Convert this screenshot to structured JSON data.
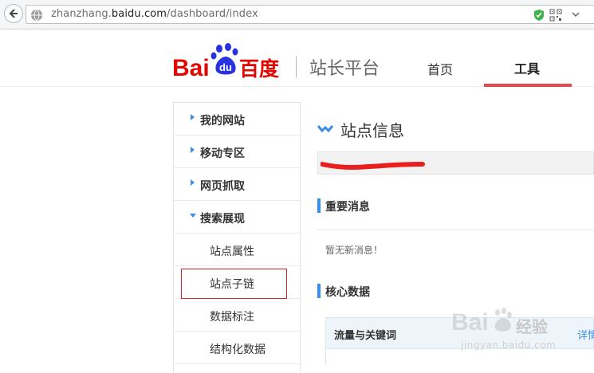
{
  "browser": {
    "url_prefix": "zhanzhang.",
    "url_domain": "baidu.com",
    "url_path": "/dashboard/index"
  },
  "header": {
    "logo_text_bai": "Bai",
    "logo_text_du": "du",
    "logo_text_cn": "百度",
    "platform": "站长平台",
    "nav": [
      {
        "label": "首页"
      },
      {
        "label": "工具"
      }
    ],
    "accent_color": "#e8484d"
  },
  "sidebar": {
    "items": [
      {
        "label": "我的网站"
      },
      {
        "label": "移动专区"
      },
      {
        "label": "网页抓取"
      },
      {
        "label": "搜索展现"
      }
    ],
    "subitems": [
      {
        "label": "站点属性"
      },
      {
        "label": "站点子链"
      },
      {
        "label": "数据标注"
      },
      {
        "label": "结构化数据"
      }
    ]
  },
  "main": {
    "title": "站点信息",
    "sections": [
      {
        "title": "重要消息"
      },
      {
        "title": "核心数据"
      }
    ],
    "no_message": "暂无新消息！",
    "table_header": "流量与关键词",
    "table_link": "详情",
    "link_color": "#3a8ee6"
  },
  "watermark": {
    "logo_text": "Bai",
    "text": "经验",
    "url": "jingyan.baidu.com"
  }
}
